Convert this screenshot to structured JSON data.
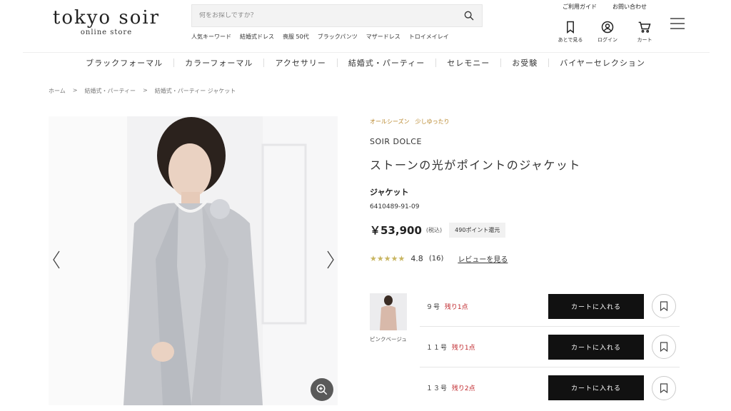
{
  "header": {
    "logo_main": "tokyo soir",
    "logo_sub": "online store",
    "search_placeholder": "何をお探しですか？",
    "keywords": [
      "人気キーワード",
      "結婚式ドレス",
      "喪服 50代",
      "ブラックパンツ",
      "マザードレス",
      "トロイメイレイ"
    ],
    "links": [
      "ご利用ガイド",
      "お問い合わせ"
    ],
    "icons": [
      {
        "icon": "bookmark-icon",
        "label": "あとで見る"
      },
      {
        "icon": "user-icon",
        "label": "ログイン"
      },
      {
        "icon": "cart-icon",
        "label": "カート"
      }
    ]
  },
  "nav": {
    "categories": [
      "ブラックフォーマル",
      "カラーフォーマル",
      "アクセサリー",
      "結婚式・パーティー",
      "セレモニー",
      "お受験",
      "バイヤーセレクション"
    ]
  },
  "breadcrumb": [
    "ホーム",
    ">",
    "結婚式・パーティー",
    ">",
    "結婚式・パーティー ジャケット"
  ],
  "product": {
    "tags": [
      "オールシーズン",
      "少しゆったり"
    ],
    "brand": "SOIR DOLCE",
    "name": "ストーンの光がポイントのジャケット",
    "type": "ジャケット",
    "code": "6410489-91-09",
    "price": "￥53,900",
    "tax": "(税込)",
    "points": "490ポイント還元",
    "stars": "★★★★★",
    "rating": "4.8",
    "review_count": "(16)",
    "review_link": "レビューを見る"
  },
  "variant": {
    "color_name": "ピンクベージュ",
    "sizes": [
      {
        "size": "９号",
        "stock": "残り1点",
        "button": "カートに入れる"
      },
      {
        "size": "１１号",
        "stock": "残り1点",
        "button": "カートに入れる"
      },
      {
        "size": "１３号",
        "stock": "残り2点",
        "button": "カートに入れる"
      }
    ]
  },
  "colors": {
    "accent_tag": "#b8862a",
    "stock_red": "#c0282d",
    "button_black": "#111111",
    "star_gold": "#c8b560"
  }
}
